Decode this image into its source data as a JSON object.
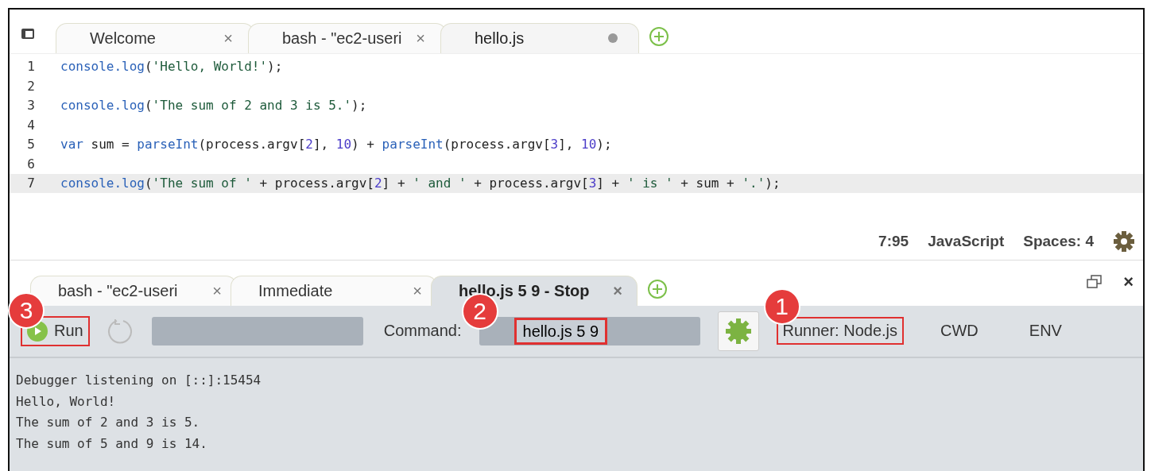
{
  "editor_tabs": [
    {
      "label": "Welcome",
      "selected": false,
      "kind": "close",
      "close": "×"
    },
    {
      "label": "bash - \"ec2-useri",
      "selected": false,
      "kind": "close",
      "close": "×"
    },
    {
      "label": "hello.js",
      "selected": true,
      "kind": "modified"
    }
  ],
  "code_lines": [
    {
      "number": "1",
      "tokens": [
        {
          "kind": "fn",
          "text": "console.log"
        },
        {
          "kind": "plain",
          "text": "("
        },
        {
          "kind": "str",
          "text": "'Hello, World!'"
        },
        {
          "kind": "plain",
          "text": ");"
        }
      ],
      "current": false
    },
    {
      "number": "2",
      "current": false
    },
    {
      "number": "3",
      "tokens": [
        {
          "kind": "fn",
          "text": "console.log"
        },
        {
          "kind": "plain",
          "text": "("
        },
        {
          "kind": "str",
          "text": "'The sum of 2 and 3 is 5.'"
        },
        {
          "kind": "plain",
          "text": ");"
        }
      ],
      "current": false
    },
    {
      "number": "4",
      "current": false
    },
    {
      "number": "5",
      "tokens": [
        {
          "kind": "fn",
          "text": "var"
        },
        {
          "kind": "plain",
          "text": " sum = "
        },
        {
          "kind": "fn",
          "text": "parseInt"
        },
        {
          "kind": "plain",
          "text": "(process.argv["
        },
        {
          "kind": "num",
          "text": "2"
        },
        {
          "kind": "plain",
          "text": "], "
        },
        {
          "kind": "num",
          "text": "10"
        },
        {
          "kind": "plain",
          "text": ") + "
        },
        {
          "kind": "fn",
          "text": "parseInt"
        },
        {
          "kind": "plain",
          "text": "(process.argv["
        },
        {
          "kind": "num",
          "text": "3"
        },
        {
          "kind": "plain",
          "text": "], "
        },
        {
          "kind": "num",
          "text": "10"
        },
        {
          "kind": "plain",
          "text": ");"
        }
      ],
      "current": false
    },
    {
      "number": "6",
      "current": false
    },
    {
      "number": "7",
      "tokens": [
        {
          "kind": "fn",
          "text": "console.log"
        },
        {
          "kind": "plain",
          "text": "("
        },
        {
          "kind": "str",
          "text": "'The sum of '"
        },
        {
          "kind": "plain",
          "text": " + process.argv["
        },
        {
          "kind": "num",
          "text": "2"
        },
        {
          "kind": "plain",
          "text": "] + "
        },
        {
          "kind": "str",
          "text": "' and '"
        },
        {
          "kind": "plain",
          "text": " + process.argv["
        },
        {
          "kind": "num",
          "text": "3"
        },
        {
          "kind": "plain",
          "text": "] + "
        },
        {
          "kind": "str",
          "text": "' is '"
        },
        {
          "kind": "plain",
          "text": " + sum + "
        },
        {
          "kind": "str",
          "text": "'.'"
        },
        {
          "kind": "plain",
          "text": ");"
        }
      ],
      "current": true
    }
  ],
  "status_bar": {
    "position": "7:95",
    "language": "JavaScript",
    "indent": "Spaces: 4"
  },
  "panel_tabs": [
    {
      "label": "bash - \"ec2-useri",
      "selected": false,
      "close": "×"
    },
    {
      "label": "Immediate",
      "selected": false,
      "close": "×"
    },
    {
      "label": "hello.js 5 9 - Stop",
      "selected": true,
      "close": "×"
    }
  ],
  "panel_close": "×",
  "runner_toolbar": {
    "run_button": {
      "label": "Run",
      "highlighted": true,
      "callout": "3"
    },
    "command_label": "Command:",
    "command": {
      "value": "hello.js 5 9",
      "highlighted": true,
      "callout": "2"
    },
    "runner": {
      "label": "Runner: Node.js",
      "highlighted": true,
      "callout": "1"
    },
    "cwd": "CWD",
    "env": "ENV"
  },
  "output_lines": [
    "Debugger listening on [::]:15454",
    "Hello, World!",
    "The sum of 2 and 3 is 5.",
    "The sum of 5 and 9 is 14."
  ]
}
